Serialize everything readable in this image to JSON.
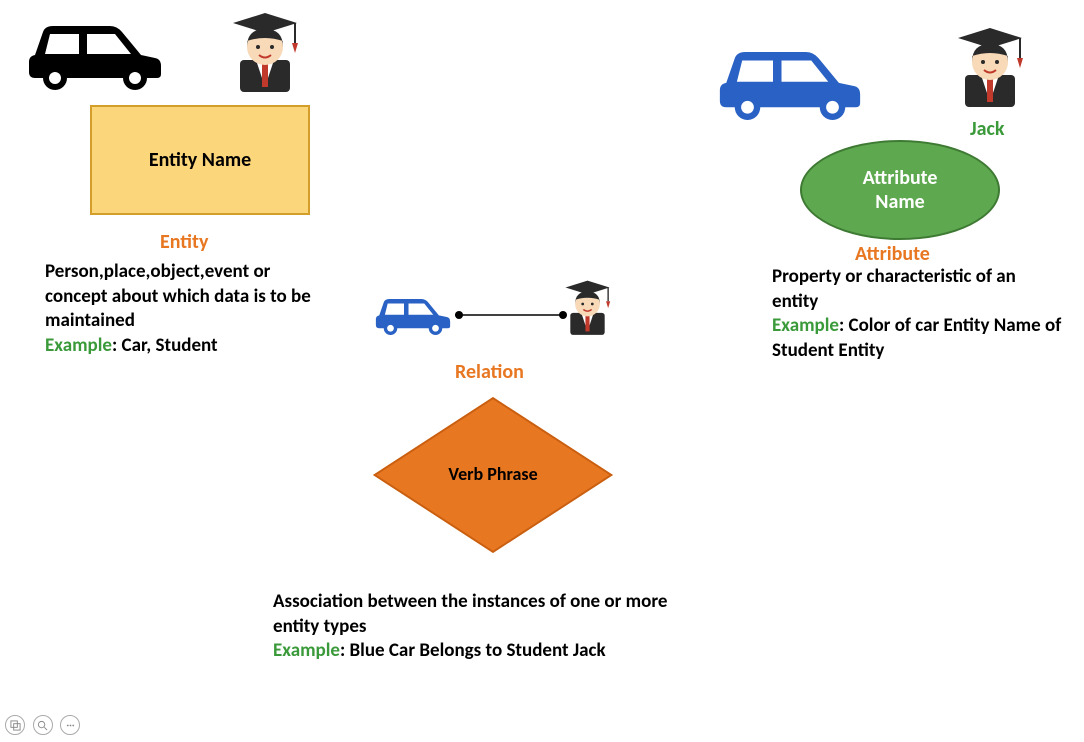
{
  "entity": {
    "box_label": "Entity Name",
    "title": "Entity",
    "description": "Person,place,object,event or concept about which data is to be maintained",
    "example_label": "Example",
    "example_text": ": Car, Student"
  },
  "relation": {
    "title": "Relation",
    "diamond_label": "Verb Phrase",
    "description": "Association between the instances of one or more entity types",
    "example_label": "Example",
    "example_text": ": Blue Car Belongs to Student Jack"
  },
  "attribute": {
    "ellipse_label": "Attribute Name",
    "title": "Attribute",
    "name_label": "Jack",
    "description": "Property or characteristic of an entity",
    "example_label": "Example",
    "example_text": ": Color of car Entity Name of Student Entity"
  },
  "icons": {
    "car_black": "car-icon",
    "car_blue": "car-icon",
    "student": "student-icon"
  }
}
